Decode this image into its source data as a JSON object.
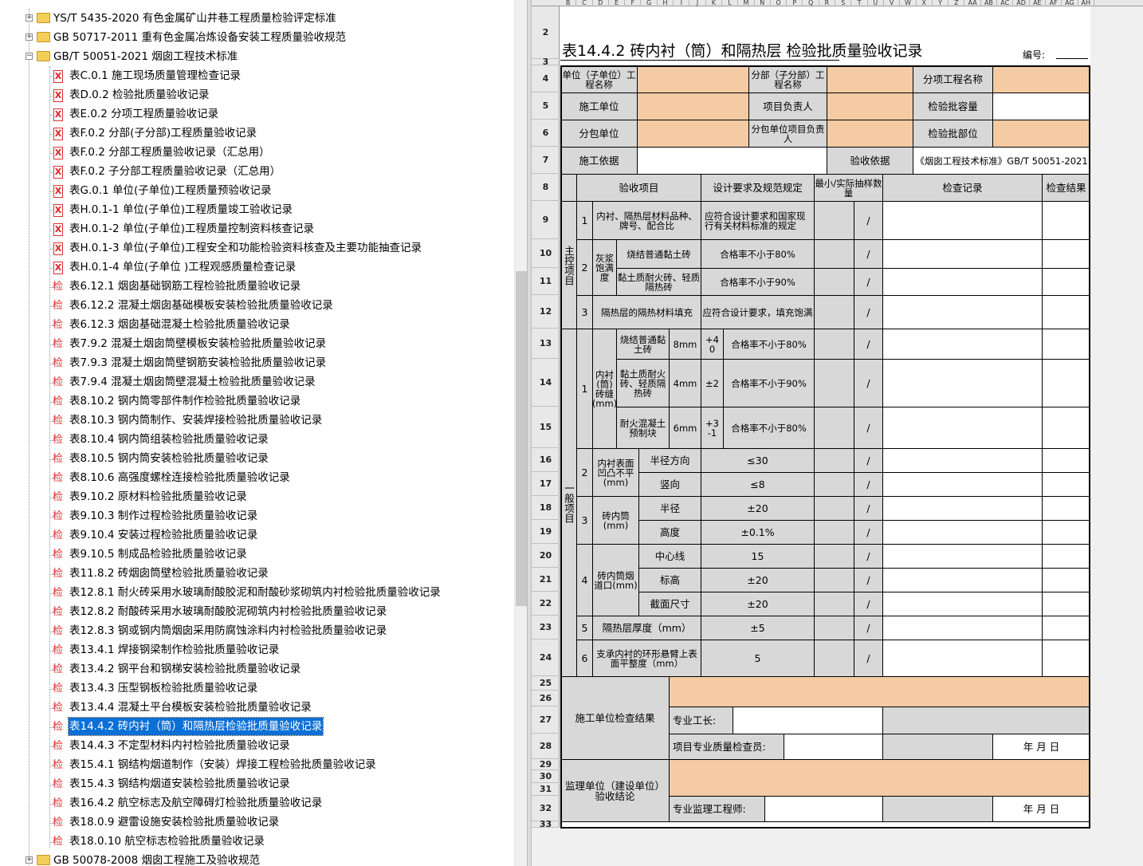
{
  "tree": {
    "standards": [
      {
        "label": "YS/T 5435-2020 有色金属矿山井巷工程质量检验评定标准",
        "expanded": false
      },
      {
        "label": "GB 50717-2011 重有色金属冶炼设备安装工程质量验收规范",
        "expanded": false
      },
      {
        "label": "GB/T 50051-2021 烟囱工程技术标准",
        "expanded": true
      }
    ],
    "forms": [
      {
        "icon": "x",
        "label": "表C.0.1 施工现场质量管理检查记录"
      },
      {
        "icon": "x",
        "label": "表D.0.2 检验批质量验收记录"
      },
      {
        "icon": "x",
        "label": "表E.0.2 分项工程质量验收记录"
      },
      {
        "icon": "x",
        "label": "表F.0.2 分部(子分部)工程质量验收记录"
      },
      {
        "icon": "x",
        "label": "表F.0.2 分部工程质量验收记录（汇总用）"
      },
      {
        "icon": "x",
        "label": "表F.0.2 子分部工程质量验收记录（汇总用）"
      },
      {
        "icon": "x",
        "label": "表G.0.1 单位(子单位)工程质量预验收记录"
      },
      {
        "icon": "x",
        "label": "表H.0.1-1 单位(子单位)工程质量竣工验收记录"
      },
      {
        "icon": "x",
        "label": "表H.0.1-2 单位(子单位)工程质量控制资料核查记录"
      },
      {
        "icon": "x",
        "label": "表H.0.1-3 单位(子单位)工程安全和功能检验资料核查及主要功能抽查记录"
      },
      {
        "icon": "x",
        "label": "表H.0.1-4 单位(子单位 )工程观感质量检查记录"
      },
      {
        "icon": "j",
        "label": "表6.12.1 烟囱基础钢筋工程检验批质量验收记录"
      },
      {
        "icon": "j",
        "label": "表6.12.2 混凝土烟囱基础模板安装检验批质量验收记录"
      },
      {
        "icon": "j",
        "label": "表6.12.3 烟囱基础混凝土检验批质量验收记录"
      },
      {
        "icon": "j",
        "label": "表7.9.2 混凝土烟囱筒壁模板安装检验批质量验收记录"
      },
      {
        "icon": "j",
        "label": "表7.9.3 混凝土烟囱筒壁钢筋安装检验批质量验收记录"
      },
      {
        "icon": "j",
        "label": "表7.9.4 混凝土烟囱筒壁混凝土检验批质量验收记录"
      },
      {
        "icon": "j",
        "label": "表8.10.2 钢内筒零部件制作检验批质量验收记录"
      },
      {
        "icon": "j",
        "label": "表8.10.3 钢内筒制作、安装焊接检验批质量验收记录"
      },
      {
        "icon": "j",
        "label": "表8.10.4 钢内筒组装检验批质量验收记录"
      },
      {
        "icon": "j",
        "label": "表8.10.5 钢内筒安装检验批质量验收记录"
      },
      {
        "icon": "j",
        "label": "表8.10.6 高强度螺栓连接检验批质量验收记录"
      },
      {
        "icon": "j",
        "label": "表9.10.2 原材料检验批质量验收记录"
      },
      {
        "icon": "j",
        "label": "表9.10.3 制作过程检验批质量验收记录"
      },
      {
        "icon": "j",
        "label": "表9.10.4 安装过程检验批质量验收记录"
      },
      {
        "icon": "j",
        "label": "表9.10.5 制成品检验批质量验收记录"
      },
      {
        "icon": "j",
        "label": "表11.8.2 砖烟囱筒壁检验批质量验收记录"
      },
      {
        "icon": "j",
        "label": "表12.8.1 耐火砖采用水玻璃耐酸胶泥和耐酸砂浆砌筑内衬检验批质量验收记录"
      },
      {
        "icon": "j",
        "label": "表12.8.2 耐酸砖采用水玻璃耐酸胶泥砌筑内衬检验批质量验收记录"
      },
      {
        "icon": "j",
        "label": "表12.8.3 钢或钢内筒烟囱采用防腐蚀涂料内衬检验批质量验收记录"
      },
      {
        "icon": "j",
        "label": "表13.4.1 焊接钢梁制作检验批质量验收记录"
      },
      {
        "icon": "j",
        "label": "表13.4.2 钢平台和钢梯安装检验批质量验收记录"
      },
      {
        "icon": "j",
        "label": "表13.4.3 压型钢板检验批质量验收记录"
      },
      {
        "icon": "j",
        "label": "表13.4.4 混凝土平台模板安装检验批质量验收记录"
      },
      {
        "icon": "j",
        "label": "表14.4.2 砖内衬（筒）和隔热层检验批质量验收记录",
        "selected": true
      },
      {
        "icon": "j",
        "label": "表14.4.3 不定型材料内衬检验批质量验收记录"
      },
      {
        "icon": "j",
        "label": "表15.4.1 钢结构烟道制作（安装）焊接工程检验批质量验收记录"
      },
      {
        "icon": "j",
        "label": "表15.4.3 钢结构烟道安装检验批质量验收记录"
      },
      {
        "icon": "j",
        "label": "表16.4.2 航空标志及航空障碍灯检验批质量验收记录"
      },
      {
        "icon": "j",
        "label": "表18.0.9 避雷设施安装检验批质量验收记录"
      },
      {
        "icon": "j",
        "label": "表18.0.10 航空标志检验批质量验收记录"
      }
    ],
    "last": {
      "label": "GB 50078-2008 烟囱工程施工及验收规范",
      "expanded": false
    },
    "icon_x_glyph": "X",
    "icon_j_glyph": "检"
  },
  "sheet": {
    "columns": [
      "B",
      "C",
      "D",
      "E",
      "F",
      "G",
      "H",
      "I",
      "J",
      "K",
      "L",
      "M",
      "N",
      "O",
      "P",
      "Q",
      "R",
      "S",
      "T",
      "U",
      "V",
      "W",
      "X",
      "Y",
      "Z",
      "AA",
      "AB",
      "AC",
      "AD",
      "AE",
      "AF",
      "AG",
      "AH"
    ],
    "rows": [
      "2",
      "3",
      "4",
      "5",
      "6",
      "7",
      "8",
      "9",
      "10",
      "11",
      "12",
      "13",
      "14",
      "15",
      "16",
      "17",
      "18",
      "19",
      "20",
      "21",
      "22",
      "23",
      "24",
      "25",
      "26",
      "27",
      "28",
      "29",
      "30",
      "31",
      "32",
      "33"
    ],
    "title": "表14.4.2  砖内衬（筒）和隔热层  检验批质量验收记录",
    "number_label": "编号:",
    "unit_name": "单位（子单位）工程名称",
    "sub_unit": "分部（子分部）工程名称",
    "item_name": "分项工程名称",
    "constructor": "施工单位",
    "proj_lead": "项目负责人",
    "capacity": "检验批容量",
    "subcontractor": "分包单位",
    "sub_lead": "分包单位项目负责人",
    "location": "检验批部位",
    "basis": "施工依据",
    "accept_basis": "验收依据",
    "standard": "《烟囱工程技术标准》GB/T 50051-2021",
    "hdr_item": "验收项目",
    "hdr_req": "设计要求及规范规定",
    "hdr_sample": "最小/实际抽样数量",
    "hdr_record": "检查记录",
    "hdr_result": "检查结果",
    "main_label": "主控项目",
    "general_label": "一般项目",
    "slash": "/",
    "m1": "内衬、隔热层材料品种、牌号、配合比",
    "m1_req": "应符合设计要求和国家现行有关材料标准的规定",
    "m2": "灰浆饱满度",
    "m2a": "烧结普通黏土砖",
    "m2a_req": "合格率不小于80%",
    "m2b": "黏土质耐火砖、轻质隔热砖",
    "m2b_req": "合格率不小于90%",
    "m3": "隔热层的隔热材料填充",
    "m3_req": "应符合设计要求，填充饱满",
    "g1": "内衬(筒)砖缝(mm)",
    "g1a": "烧结普通黏土砖",
    "g1a_w": "8mm",
    "g1a_t": "+4 0",
    "g1a_r": "合格率不小于80%",
    "g1b": "黏土质耐火砖、轻质隔热砖",
    "g1b_w": "4mm",
    "g1b_t": "±2",
    "g1b_r": "合格率不小于90%",
    "g1c": "耐火混凝土预制块",
    "g1c_w": "6mm",
    "g1c_t": "+3 -1",
    "g1c_r": "合格率不小于80%",
    "g2": "内衬表面凹凸不平(mm)",
    "g2a": "半径方向",
    "g2a_v": "≤30",
    "g2b": "竖向",
    "g2b_v": "≤8",
    "g3": "砖内筒(mm)",
    "g3a": "半径",
    "g3a_v": "±20",
    "g3b": "高度",
    "g3b_v": "±0.1%",
    "g4": "砖内筒烟道口(mm)",
    "g4a": "中心线",
    "g4a_v": "15",
    "g4b": "标高",
    "g4b_v": "±20",
    "g4c": "截面尺寸",
    "g4c_v": "±20",
    "g5": "隔热层厚度（mm）",
    "g5_v": "±5",
    "g6": "支承内衬的环形悬臂上表面平整度（mm）",
    "g6_v": "5",
    "n1": "1",
    "n2": "2",
    "n3": "3",
    "n4": "4",
    "n5": "5",
    "n6": "6",
    "constr_check": "施工单位检查结果",
    "foreman": "专业工长:",
    "qc": "项目专业质量检查员:",
    "date": "年    月    日",
    "sup_check": "监理单位（建设单位）验收结论",
    "sup_eng": "专业监理工程师:"
  }
}
